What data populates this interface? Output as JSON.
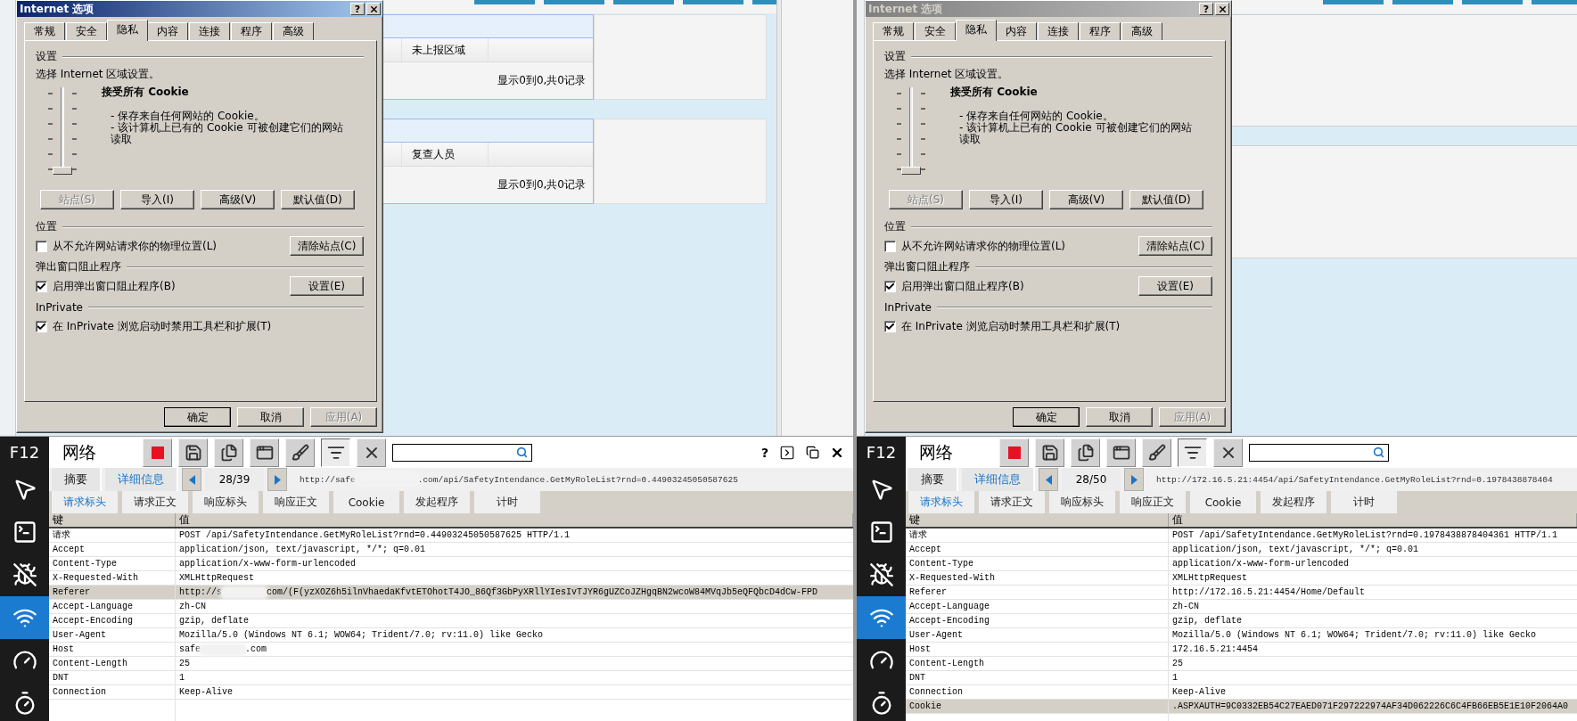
{
  "panes": [
    {
      "page": {
        "panels": [
          {
            "cell": "未上报区域",
            "footer": "显示0到0,共0记录"
          },
          {
            "cell": "复查人员",
            "footer": "显示0到0,共0记录"
          }
        ]
      },
      "dialog": {
        "title": "Internet 选项",
        "active": true,
        "help": "?",
        "tabs": [
          {
            "label": "常规",
            "selected": false
          },
          {
            "label": "安全",
            "selected": false
          },
          {
            "label": "隐私",
            "selected": true
          },
          {
            "label": "内容",
            "selected": false
          },
          {
            "label": "连接",
            "selected": false
          },
          {
            "label": "程序",
            "selected": false
          },
          {
            "label": "高级",
            "selected": false
          }
        ],
        "settings": {
          "heading": "设置",
          "prompt": "选择 Internet 区域设置。",
          "slider": {
            "level": 0
          },
          "level_name": "接受所有 Cookie",
          "details": [
            "- 保存来自任何网站的 Cookie。",
            "- 该计算机上已有的 Cookie 可被创建它们的网站读取"
          ],
          "buttons": [
            {
              "label": "站点(S)",
              "disabled": true
            },
            {
              "label": "导入(I)",
              "disabled": false
            },
            {
              "label": "高级(V)",
              "disabled": false
            },
            {
              "label": "默认值(D)",
              "disabled": false
            }
          ]
        },
        "groups": [
          {
            "heading": "位置",
            "checkbox": {
              "label": "从不允许网站请求你的物理位置(L)",
              "checked": false
            },
            "button": "清除站点(C)"
          },
          {
            "heading": "弹出窗口阻止程序",
            "checkbox": {
              "label": "启用弹出窗口阻止程序(B)",
              "checked": true
            },
            "button": "设置(E)"
          },
          {
            "heading": "InPrivate",
            "checkbox": {
              "label": "在 InPrivate 浏览启动时禁用工具栏和扩展(T)",
              "checked": true
            }
          }
        ],
        "footer_buttons": [
          {
            "label": "确定",
            "default": true,
            "disabled": false
          },
          {
            "label": "取消",
            "default": false,
            "disabled": false
          },
          {
            "label": "应用(A)",
            "default": false,
            "disabled": true
          }
        ]
      },
      "devtools": {
        "badge": "F12",
        "tools": [
          {
            "kind": "pointer",
            "selected": false
          },
          {
            "kind": "console",
            "selected": false
          },
          {
            "kind": "debugger",
            "selected": false
          },
          {
            "kind": "network",
            "selected": true
          },
          {
            "kind": "performance",
            "selected": false
          },
          {
            "kind": "memory",
            "selected": false
          }
        ],
        "title": "网络",
        "toolbar": [
          {
            "kind": "stop",
            "pressed": false
          },
          {
            "kind": "save",
            "pressed": false
          },
          {
            "kind": "files",
            "pressed": false
          },
          {
            "kind": "window",
            "pressed": false
          },
          {
            "kind": "brush",
            "pressed": false
          },
          {
            "kind": "list",
            "pressed": true
          },
          {
            "kind": "clear",
            "pressed": false
          }
        ],
        "help": "?",
        "views": [
          {
            "label": "摘要",
            "selected": false
          },
          {
            "label": "详细信息",
            "selected": true
          }
        ],
        "counter": "28/39",
        "url": "http://safe",
        "url_end": ".com/api/SafetyIntendance.GetMyRoleList?rnd=0.44903245050587625",
        "subtabs": [
          {
            "label": "请求标头",
            "selected": true
          },
          {
            "label": "请求正文",
            "selected": false
          },
          {
            "label": "响应标头",
            "selected": false
          },
          {
            "label": "响应正文",
            "selected": false
          },
          {
            "label": "Cookie",
            "selected": false
          },
          {
            "label": "发起程序",
            "selected": false
          },
          {
            "label": "计时",
            "selected": false
          }
        ],
        "columns": [
          "键",
          "值"
        ],
        "rows": [
          {
            "key": "请求",
            "value": "POST /api/SafetyIntendance.GetMyRoleList?rnd=0.44903245050587625 HTTP/1.1",
            "selected": false
          },
          {
            "key": "Accept",
            "value": "application/json, text/javascript, */*; q=0.01",
            "selected": false
          },
          {
            "key": "Content-Type",
            "value": "application/x-www-form-urlencoded",
            "selected": false
          },
          {
            "key": "X-Requested-With",
            "value": "XMLHttpRequest",
            "selected": false
          },
          {
            "key": "Referer",
            "value": "http://s",
            "value_end": "com/(F(yzXOZ6h5ilnVhaedaKfvtETOhotT4JO_86Qf3GbPyXRllYIesIvTJYR6gUZCoJZHgqBN2wcoW84MVqJb5eQFQbcD4dCw-FPD",
            "selected": true
          },
          {
            "key": "Accept-Language",
            "value": "zh-CN",
            "selected": false
          },
          {
            "key": "Accept-Encoding",
            "value": "gzip, deflate",
            "selected": false
          },
          {
            "key": "User-Agent",
            "value": "Mozilla/5.0 (Windows NT 6.1; WOW64; Trident/7.0; rv:11.0) like Gecko",
            "selected": false
          },
          {
            "key": "Host",
            "value": "safe",
            "value_end": ".com",
            "selected": false
          },
          {
            "key": "Content-Length",
            "value": "25",
            "selected": false
          },
          {
            "key": "DNT",
            "value": "1",
            "selected": false
          },
          {
            "key": "Connection",
            "value": "Keep-Alive",
            "selected": false
          }
        ]
      }
    },
    {
      "dialog": {
        "title": "Internet 选项",
        "active": false,
        "help": "?",
        "tabs": [
          {
            "label": "常规",
            "selected": false
          },
          {
            "label": "安全",
            "selected": false
          },
          {
            "label": "隐私",
            "selected": true
          },
          {
            "label": "内容",
            "selected": false
          },
          {
            "label": "连接",
            "selected": false
          },
          {
            "label": "程序",
            "selected": false
          },
          {
            "label": "高级",
            "selected": false
          }
        ],
        "settings": {
          "heading": "设置",
          "prompt": "选择 Internet 区域设置。",
          "slider": {
            "level": 0
          },
          "level_name": "接受所有 Cookie",
          "details": [
            "- 保存来自任何网站的 Cookie。",
            "- 该计算机上已有的 Cookie 可被创建它们的网站读取"
          ],
          "buttons": [
            {
              "label": "站点(S)",
              "disabled": true
            },
            {
              "label": "导入(I)",
              "disabled": false
            },
            {
              "label": "高级(V)",
              "disabled": false
            },
            {
              "label": "默认值(D)",
              "disabled": false
            }
          ]
        },
        "groups": [
          {
            "heading": "位置",
            "checkbox": {
              "label": "从不允许网站请求你的物理位置(L)",
              "checked": false
            },
            "button": "清除站点(C)"
          },
          {
            "heading": "弹出窗口阻止程序",
            "checkbox": {
              "label": "启用弹出窗口阻止程序(B)",
              "checked": true
            },
            "button": "设置(E)"
          },
          {
            "heading": "InPrivate",
            "checkbox": {
              "label": "在 InPrivate 浏览启动时禁用工具栏和扩展(T)",
              "checked": true
            }
          }
        ],
        "footer_buttons": [
          {
            "label": "确定",
            "default": true,
            "disabled": false
          },
          {
            "label": "取消",
            "default": false,
            "disabled": false
          },
          {
            "label": "应用(A)",
            "default": false,
            "disabled": true
          }
        ]
      },
      "devtools": {
        "badge": "F12",
        "tools": [
          {
            "kind": "pointer",
            "selected": false
          },
          {
            "kind": "console",
            "selected": false
          },
          {
            "kind": "debugger",
            "selected": false
          },
          {
            "kind": "network",
            "selected": true
          },
          {
            "kind": "performance",
            "selected": false
          },
          {
            "kind": "memory",
            "selected": false
          }
        ],
        "title": "网络",
        "toolbar": [
          {
            "kind": "stop",
            "pressed": false
          },
          {
            "kind": "save",
            "pressed": false
          },
          {
            "kind": "files",
            "pressed": false
          },
          {
            "kind": "window",
            "pressed": false
          },
          {
            "kind": "brush",
            "pressed": false
          },
          {
            "kind": "list",
            "pressed": true
          },
          {
            "kind": "clear",
            "pressed": false
          }
        ],
        "views": [
          {
            "label": "摘要",
            "selected": false
          },
          {
            "label": "详细信息",
            "selected": true
          }
        ],
        "counter": "28/50",
        "url": "http://172.16.5.21:4454/api/SafetyIntendance.GetMyRoleList?rnd=0.1978438878404",
        "subtabs": [
          {
            "label": "请求标头",
            "selected": true
          },
          {
            "label": "请求正文",
            "selected": false
          },
          {
            "label": "响应标头",
            "selected": false
          },
          {
            "label": "响应正文",
            "selected": false
          },
          {
            "label": "Cookie",
            "selected": false
          },
          {
            "label": "发起程序",
            "selected": false
          },
          {
            "label": "计时",
            "selected": false
          }
        ],
        "columns": [
          "键",
          "值"
        ],
        "rows": [
          {
            "key": "请求",
            "value": "POST /api/SafetyIntendance.GetMyRoleList?rnd=0.1978438878404361 HTTP/1.1",
            "selected": false
          },
          {
            "key": "Accept",
            "value": "application/json, text/javascript, */*; q=0.01",
            "selected": false
          },
          {
            "key": "Content-Type",
            "value": "application/x-www-form-urlencoded",
            "selected": false
          },
          {
            "key": "X-Requested-With",
            "value": "XMLHttpRequest",
            "selected": false
          },
          {
            "key": "Referer",
            "value": "http://172.16.5.21:4454/Home/Default",
            "selected": false
          },
          {
            "key": "Accept-Language",
            "value": "zh-CN",
            "selected": false
          },
          {
            "key": "Accept-Encoding",
            "value": "gzip, deflate",
            "selected": false
          },
          {
            "key": "User-Agent",
            "value": "Mozilla/5.0 (Windows NT 6.1; WOW64; Trident/7.0; rv:11.0) like Gecko",
            "selected": false
          },
          {
            "key": "Host",
            "value": "172.16.5.21:4454",
            "selected": false
          },
          {
            "key": "Content-Length",
            "value": "25",
            "selected": false
          },
          {
            "key": "DNT",
            "value": "1",
            "selected": false
          },
          {
            "key": "Connection",
            "value": "Keep-Alive",
            "selected": false
          },
          {
            "key": "Cookie",
            "value": ".ASPXAUTH=9C0332EB54C27EAED071F297222974AF34D062226C6C4FB66EB5E1E10F2064A0",
            "selected": true
          }
        ]
      }
    }
  ]
}
